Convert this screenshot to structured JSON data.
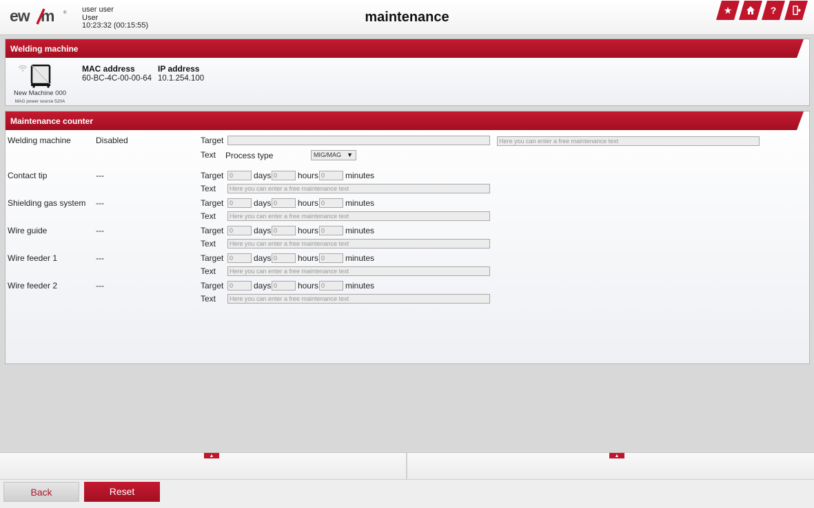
{
  "header": {
    "logo_text": "ewm",
    "user_name": "user user",
    "user_role": "User",
    "time": "10:23:32 (00:15:55)",
    "title": "maintenance",
    "buttons": [
      {
        "icon": "star-icon",
        "label": "★"
      },
      {
        "icon": "home-icon",
        "label": ""
      },
      {
        "icon": "help-icon",
        "label": "?"
      },
      {
        "icon": "logout-icon",
        "label": ""
      }
    ]
  },
  "welding_machine": {
    "section_title": "Welding machine",
    "machine_name": "New Machine 000",
    "machine_type": "MAG power source 520A",
    "mac_label": "MAC address",
    "mac_value": "60-BC-4C-00-00-64",
    "ip_label": "IP address",
    "ip_value": "10.1.254.100"
  },
  "maintenance_counter": {
    "section_title": "Maintenance counter",
    "target_label": "Target",
    "text_label": "Text",
    "days_label": "days",
    "hours_label": "hours",
    "minutes_label": "minutes",
    "text_placeholder": "Here you can enter a free maintenance text",
    "welding_machine": {
      "label": "Welding machine",
      "status": "Disabled",
      "process_type_label": "Process type",
      "process_type_value": "MIG/MAG"
    },
    "items": [
      {
        "label": "Contact tip",
        "status": "---",
        "days": "0",
        "hours": "0",
        "minutes": "0"
      },
      {
        "label": "Shielding gas system",
        "status": "---",
        "days": "0",
        "hours": "0",
        "minutes": "0"
      },
      {
        "label": "Wire guide",
        "status": "---",
        "days": "0",
        "hours": "0",
        "minutes": "0"
      },
      {
        "label": "Wire feeder 1",
        "status": "---",
        "days": "0",
        "hours": "0",
        "minutes": "0"
      },
      {
        "label": "Wire feeder 2",
        "status": "---",
        "days": "0",
        "hours": "0",
        "minutes": "0"
      }
    ]
  },
  "footer": {
    "back_label": "Back",
    "reset_label": "Reset"
  },
  "colors": {
    "accent": "#c0152b",
    "background": "#d8d8d8"
  }
}
